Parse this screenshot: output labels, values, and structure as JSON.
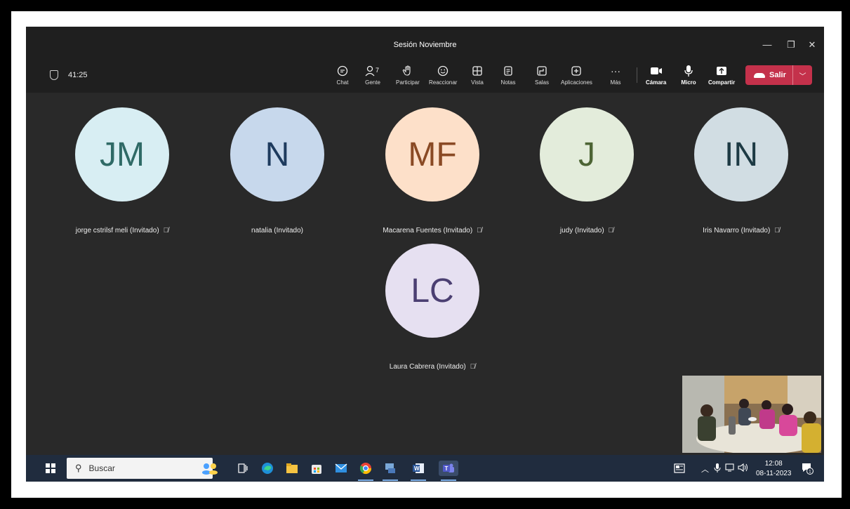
{
  "window": {
    "title": "Sesión Noviembre"
  },
  "toolbar": {
    "timer": "41:25",
    "people_count": "7",
    "buttons": {
      "chat": "Chat",
      "people": "Gente",
      "raise_hand": "Participar",
      "react": "Reaccionar",
      "view": "Vista",
      "notes": "Notas",
      "rooms": "Salas",
      "apps": "Aplicaciones",
      "more": "Más",
      "camera": "Cámara",
      "mic": "Micro",
      "share": "Compartir"
    },
    "leave_label": "Salir",
    "leave_color": "#c4314b"
  },
  "participants": [
    {
      "initials": "JM",
      "name": "jorge cstrilsf meli (Invitado)",
      "bg": "#d8eef3",
      "fg": "#2f6a66",
      "muted": true
    },
    {
      "initials": "N",
      "name": "natalia (Invitado)",
      "bg": "#c7d8ec",
      "fg": "#1e3b5e",
      "muted": false
    },
    {
      "initials": "MF",
      "name": "Macarena Fuentes (Invitado)",
      "bg": "#fde0c9",
      "fg": "#8a4a24",
      "muted": true
    },
    {
      "initials": "J",
      "name": "judy (Invitado)",
      "bg": "#e3ecdb",
      "fg": "#4c6434",
      "muted": true
    },
    {
      "initials": "IN",
      "name": "Iris Navarro (Invitado)",
      "bg": "#d1dde3",
      "fg": "#1d3a44",
      "muted": true
    },
    {
      "initials": "LC",
      "name": "Laura Cabrera (Invitado)",
      "bg": "#e6e0f1",
      "fg": "#4b3f72",
      "muted": true
    }
  ],
  "taskbar": {
    "search_label": "Buscar",
    "time": "12:08",
    "date": "08-11-2023",
    "notification_count": "1"
  }
}
